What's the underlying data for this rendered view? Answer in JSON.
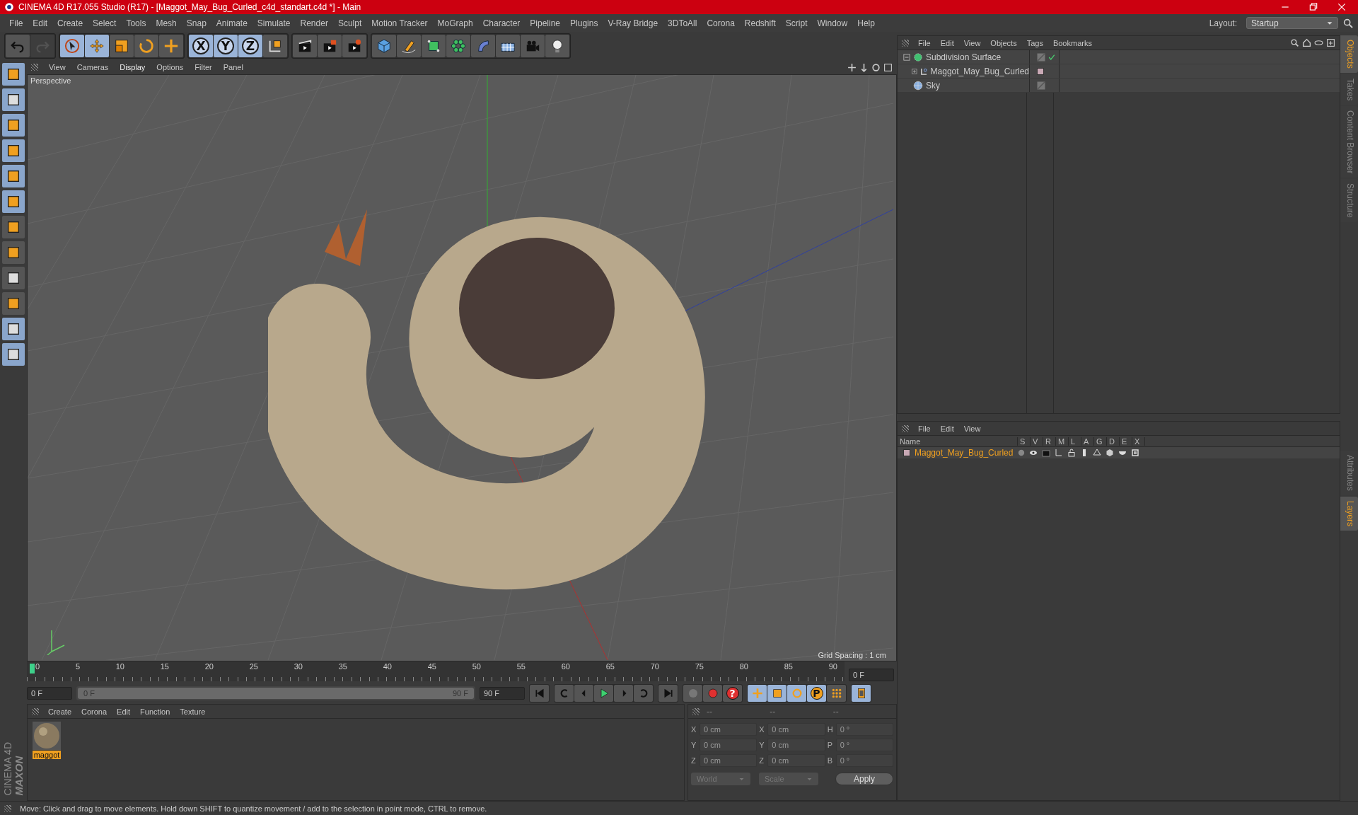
{
  "title_bar": {
    "title": "CINEMA 4D R17.055 Studio (R17) - [Maggot_May_Bug_Curled_c4d_standart.c4d *] - Main"
  },
  "menu_bar": [
    "File",
    "Edit",
    "Create",
    "Select",
    "Tools",
    "Mesh",
    "Snap",
    "Animate",
    "Simulate",
    "Render",
    "Sculpt",
    "Motion Tracker",
    "MoGraph",
    "Character",
    "Pipeline",
    "Plugins",
    "V-Ray Bridge",
    "3DToAll",
    "Corona",
    "Redshift",
    "Script",
    "Window",
    "Help"
  ],
  "layout": {
    "label": "Layout:",
    "value": "Startup"
  },
  "toolbar": [
    {
      "selected": false,
      "disabled": false
    },
    {
      "selected": false,
      "disabled": true
    },
    {
      "selected": true,
      "disabled": false
    },
    {
      "selected": true,
      "disabled": false
    },
    {
      "selected": false,
      "disabled": false
    },
    {
      "selected": false,
      "disabled": false
    },
    {
      "selected": false,
      "disabled": false
    },
    {
      "label": "X",
      "selected": true,
      "disabled": false
    },
    {
      "label": "Y",
      "selected": true,
      "disabled": false
    },
    {
      "label": "Z",
      "selected": true,
      "disabled": false
    },
    {
      "selected": false,
      "disabled": false
    },
    {
      "selected": false,
      "disabled": false
    },
    {
      "selected": false,
      "disabled": false
    },
    {
      "selected": false,
      "disabled": false
    },
    {
      "selected": false,
      "disabled": false
    },
    {
      "selected": false,
      "disabled": false
    },
    {
      "selected": false,
      "disabled": false
    },
    {
      "selected": false,
      "disabled": false
    },
    {
      "selected": false,
      "disabled": false
    },
    {
      "selected": false,
      "disabled": false
    },
    {
      "selected": false,
      "disabled": false
    },
    {
      "selected": false,
      "disabled": false
    }
  ],
  "viewport": {
    "menu": [
      {
        "label": "View",
        "selected": false
      },
      {
        "label": "Cameras",
        "selected": false
      },
      {
        "label": "Display",
        "selected": true
      },
      {
        "label": "Options",
        "selected": false
      },
      {
        "label": "Filter",
        "selected": false
      },
      {
        "label": "Panel",
        "selected": false
      }
    ],
    "camera": "Perspective",
    "grid_spacing": "Grid Spacing : 1 cm"
  },
  "timeline": {
    "ticks": [
      "0",
      "5",
      "10",
      "15",
      "20",
      "25",
      "30",
      "35",
      "40",
      "45",
      "50",
      "55",
      "60",
      "65",
      "70",
      "75",
      "80",
      "85",
      "90"
    ],
    "current_frame": "0 F"
  },
  "playback": {
    "level": 1,
    "start": "0 F",
    "range_start": "0 F",
    "range_end": "90 F",
    "end": "90 F",
    "key_tools": [
      {
        "selected": false
      },
      {
        "selected": false
      },
      {
        "label": "?",
        "selected": false
      },
      {
        "selected": true
      },
      {
        "selected": true
      },
      {
        "selected": true
      },
      {
        "label": "P",
        "selected": true
      },
      {
        "selected": false
      },
      {
        "selected": true
      }
    ]
  },
  "materials": {
    "menu": [
      "Create",
      "Corona",
      "Edit",
      "Function",
      "Texture"
    ],
    "items": [
      {
        "name": "maggot",
        "selected": true
      }
    ]
  },
  "coordinates": {
    "headers": [
      "--",
      "--",
      "--"
    ],
    "rows": [
      [
        {
          "axis": "X",
          "value": "0 cm"
        },
        {
          "axis": "X",
          "value": "0 cm"
        },
        {
          "axis": "H",
          "value": "0 °"
        }
      ],
      [
        {
          "axis": "Y",
          "value": "0 cm"
        },
        {
          "axis": "Y",
          "value": "0 cm"
        },
        {
          "axis": "P",
          "value": "0 °"
        }
      ],
      [
        {
          "axis": "Z",
          "value": "0 cm"
        },
        {
          "axis": "Z",
          "value": "0 cm"
        },
        {
          "axis": "B",
          "value": "0 °"
        }
      ]
    ],
    "dropdowns": [
      "World",
      "Scale"
    ],
    "apply": "Apply"
  },
  "objects": {
    "menu": [
      "File",
      "Edit",
      "View",
      "Objects",
      "Tags",
      "Bookmarks"
    ],
    "items": [
      {
        "name": "Subdivision Surface",
        "kind": "generator",
        "expanded": true,
        "checked": true,
        "children": [
          {
            "name": "Maggot_May_Bug_Curled",
            "kind": "null",
            "expanded": false,
            "checked": false
          }
        ]
      },
      {
        "name": "Sky",
        "kind": "sky",
        "checked": false
      }
    ]
  },
  "layers": {
    "menu": [
      "File",
      "Edit",
      "View"
    ],
    "columns": [
      "Name",
      "S",
      "V",
      "R",
      "M",
      "L",
      "A",
      "G",
      "D",
      "E",
      "X"
    ],
    "rows": [
      {
        "name": "Maggot_May_Bug_Curled",
        "color": "#c9a9b5"
      }
    ]
  },
  "side_tabs": {
    "top": [
      {
        "label": "Objects",
        "selected": true
      },
      {
        "label": "Takes",
        "selected": false
      },
      {
        "label": "Content Browser",
        "selected": false
      },
      {
        "label": "Structure",
        "selected": false
      }
    ],
    "bottom": [
      {
        "label": "Attributes",
        "selected": false
      },
      {
        "label": "Layers",
        "selected": true
      }
    ]
  },
  "brand": {
    "company": "MAXON",
    "product": "CINEMA 4D"
  },
  "status_bar": "Move: Click and drag to move elements. Hold down SHIFT to quantize movement / add to the selection in point mode, CTRL to remove."
}
